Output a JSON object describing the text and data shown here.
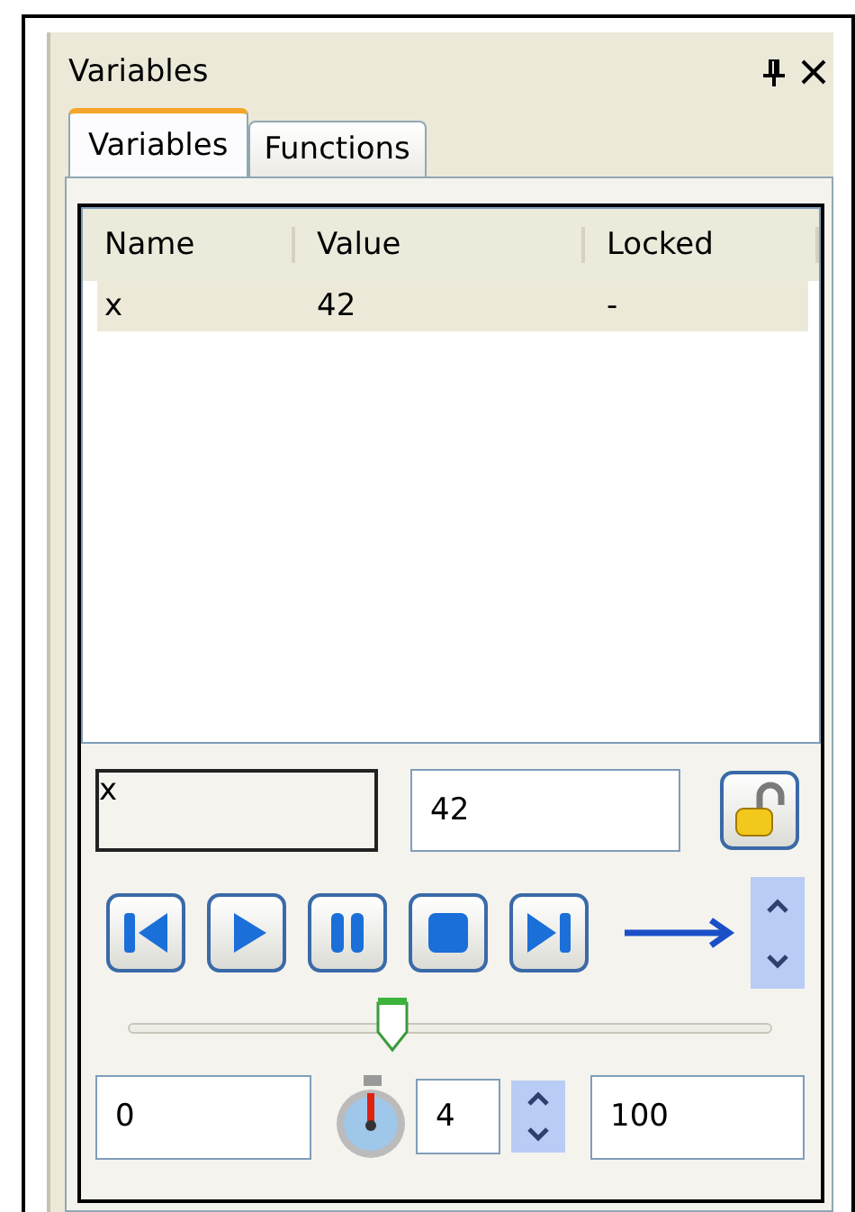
{
  "panel": {
    "title": "Variables"
  },
  "tabs": [
    {
      "label": "Variables",
      "selected": true
    },
    {
      "label": "Functions",
      "selected": false
    }
  ],
  "table": {
    "columns": [
      "Name",
      "Value",
      "Locked"
    ],
    "rows": [
      {
        "cells": [
          "x",
          "42",
          "-"
        ],
        "selected": true
      }
    ]
  },
  "editor": {
    "name": "x",
    "value": "42"
  },
  "slider": {
    "level": 0.41
  },
  "range": {
    "min": "0",
    "interval": "4",
    "max": "100"
  }
}
